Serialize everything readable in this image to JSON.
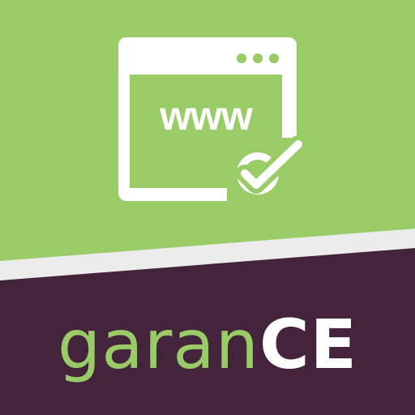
{
  "logo": {
    "url_label": "www",
    "wordmark_light": "garan",
    "wordmark_bold": "CE",
    "icons": {
      "browser": "browser-window-icon",
      "check": "checkmark-badge-icon"
    }
  },
  "colors": {
    "green": "#99cc66",
    "white": "#ffffff",
    "plum": "#43243b",
    "stripe": "#ececec"
  }
}
